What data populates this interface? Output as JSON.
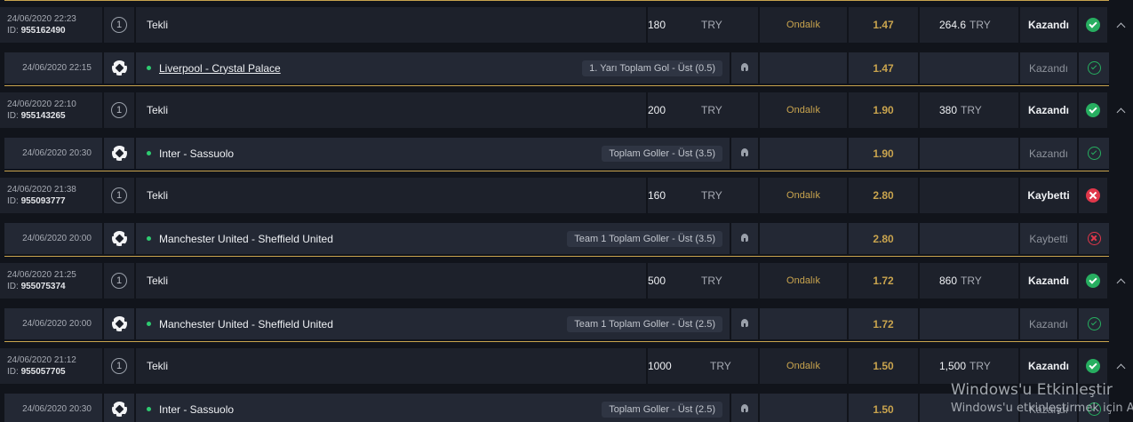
{
  "watermark": {
    "title": "Windows'u Etkinleştir",
    "subtitle": "Windows'u etkinleştirmek için A"
  },
  "colors": {
    "accent": "#c9a44e",
    "won": "#27ae60",
    "lost": "#e0374a",
    "live_dot": "#2ecc71"
  },
  "coupons": [
    {
      "bet": {
        "date": "24/06/2020 22:23",
        "id_label": "ID:",
        "id": "955162490",
        "type_icon": "circled-1-icon",
        "type": "Tekli",
        "stake": "180",
        "currency": "TRY",
        "odds_format": "Ondalık",
        "total_odds": "1.47",
        "winnings": "264.6",
        "winnings_currency": "TRY",
        "status": "Kazandı",
        "status_kind": "won",
        "expand": true
      },
      "event": {
        "date": "24/06/2020 22:15",
        "sport_icon": "football-icon",
        "name": "Liverpool - Crystal Palace",
        "linked": true,
        "market": "1. Yarı Toplam Gol - Üst (0.5)",
        "odd": "1.47",
        "status": "Kazandı",
        "status_kind": "won"
      }
    },
    {
      "bet": {
        "date": "24/06/2020 22:10",
        "id_label": "ID:",
        "id": "955143265",
        "type_icon": "circled-1-icon",
        "type": "Tekli",
        "stake": "200",
        "currency": "TRY",
        "odds_format": "Ondalık",
        "total_odds": "1.90",
        "winnings": "380",
        "winnings_currency": "TRY",
        "status": "Kazandı",
        "status_kind": "won",
        "expand": true
      },
      "event": {
        "date": "24/06/2020 20:30",
        "sport_icon": "football-icon",
        "name": "Inter - Sassuolo",
        "linked": false,
        "market": "Toplam Goller - Üst (3.5)",
        "odd": "1.90",
        "status": "Kazandı",
        "status_kind": "won"
      }
    },
    {
      "bet": {
        "date": "24/06/2020 21:38",
        "id_label": "ID:",
        "id": "955093777",
        "type_icon": "circled-1-icon",
        "type": "Tekli",
        "stake": "160",
        "currency": "TRY",
        "odds_format": "Ondalık",
        "total_odds": "2.80",
        "winnings": "",
        "winnings_currency": "",
        "status": "Kaybetti",
        "status_kind": "lost",
        "expand": false
      },
      "event": {
        "date": "24/06/2020 20:00",
        "sport_icon": "football-icon",
        "name": "Manchester United - Sheffield United",
        "linked": false,
        "market": "Team 1 Toplam Goller - Üst (3.5)",
        "odd": "2.80",
        "status": "Kaybetti",
        "status_kind": "lost"
      }
    },
    {
      "bet": {
        "date": "24/06/2020 21:25",
        "id_label": "ID:",
        "id": "955075374",
        "type_icon": "circled-1-icon",
        "type": "Tekli",
        "stake": "500",
        "currency": "TRY",
        "odds_format": "Ondalık",
        "total_odds": "1.72",
        "winnings": "860",
        "winnings_currency": "TRY",
        "status": "Kazandı",
        "status_kind": "won",
        "expand": true
      },
      "event": {
        "date": "24/06/2020 20:00",
        "sport_icon": "football-icon",
        "name": "Manchester United - Sheffield United",
        "linked": false,
        "market": "Team 1 Toplam Goller - Üst (2.5)",
        "odd": "1.72",
        "status": "Kazandı",
        "status_kind": "won"
      }
    },
    {
      "bet": {
        "date": "24/06/2020 21:12",
        "id_label": "ID:",
        "id": "955057705",
        "type_icon": "circled-1-icon",
        "type": "Tekli",
        "stake": "1000",
        "currency": "TRY",
        "odds_format": "Ondalık",
        "total_odds": "1.50",
        "winnings": "1,500",
        "winnings_currency": "TRY",
        "status": "Kazandı",
        "status_kind": "won",
        "expand": true
      },
      "event": {
        "date": "24/06/2020 20:30",
        "sport_icon": "football-icon",
        "name": "Inter - Sassuolo",
        "linked": false,
        "market": "Toplam Goller - Üst (2.5)",
        "odd": "1.50",
        "status": "Kazandı",
        "status_kind": "won"
      }
    }
  ]
}
